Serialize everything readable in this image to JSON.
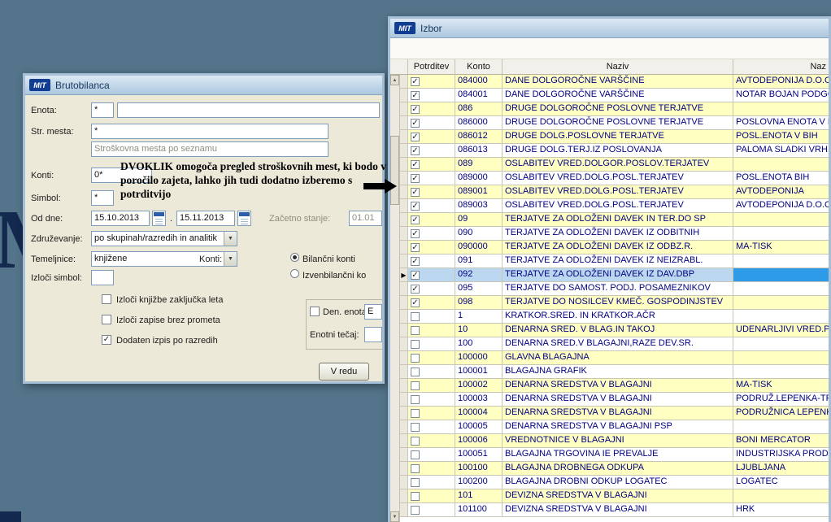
{
  "icons": {
    "dropdown_arrow": "▼",
    "up_arrow": "▲",
    "down_arrow": "▼",
    "check": "✓",
    "record_pointer": "▶"
  },
  "colors": {
    "desktop": "#53748A",
    "row_yellow": "#FFFFC2",
    "row_white": "#FFFFFF",
    "row_selected": "#BCD8F0",
    "active_cell": "#2E9BE8",
    "grid_text": "#000080"
  },
  "brand": {
    "logo": "MIT"
  },
  "background": {
    "letter": "M"
  },
  "annotation": {
    "lines": [
      "DVOKLIK omogoča pregled stroškovnih mest, ki bodo v",
      "poročilo zajeta, lahko jih tudi dodatno izberemo s",
      "potrditvijo"
    ]
  },
  "brutobilanca": {
    "title": "Brutobilanca",
    "enota_label": "Enota:",
    "enota_value": "*",
    "enota_name_value": "",
    "str_mesta_label": "Str. mesta:",
    "str_mesta_value": "*",
    "str_mesta_hint": "Stroškovna mesta po seznamu",
    "konti_label": "Konti:",
    "konti_value": "0*",
    "simbol_label": "Simbol:",
    "simbol_value": "*",
    "od_dne_label": "Od dne:",
    "date_from": "15.10.2013",
    "date_separator": ".",
    "date_to": "15.11.2013",
    "zacetno_stanje_label": "Začetno stanje:",
    "zacetno_stanje_value": "01.01",
    "zdruzevanje_label": "Združevanje:",
    "zdruzevanje_value": "po skupinah/razredih in analitik",
    "temeljnice_label": "Temeljnice:",
    "temeljnice_value": "knjižene",
    "konti_group_label": "Konti:",
    "radio_bilancni_label": "Bilančni konti",
    "radio_izvenbilancni_label": "Izvenbilančni ko",
    "radio_states": {
      "bilancni": true,
      "izvenbilancni": false
    },
    "izloci_simbol_label": "Izloči simbol:",
    "izloci_simbol_value": "",
    "checkbox_izloci_knjizbe_label": "Izloči knjižbe zaključka leta",
    "checkbox_izloci_zapise_label": "Izloči zapise brez prometa",
    "checkbox_dodaten_izpis_label": "Dodaten izpis po razredih",
    "checkbox_states": {
      "izloci_knjizbe": false,
      "izloci_zapise": false,
      "dodaten_izpis": true,
      "den_enota": false
    },
    "den_enota_label": "Den. enota:",
    "den_enota_value": "E",
    "enotni_tecaj_label": "Enotni tečaj:",
    "enotni_tecaj_value": "",
    "ok_button": "V redu"
  },
  "izbor": {
    "title": "Izbor",
    "columns": [
      "Potrditev",
      "Konto",
      "Naziv",
      "Naz"
    ],
    "selected_index": 14,
    "rows": [
      {
        "checked": true,
        "konto": "084000",
        "naziv": "DANE DOLGOROČNE VARŠČINE",
        "naziv2": "AVTODEPONIJA D.O.O."
      },
      {
        "checked": true,
        "konto": "084001",
        "naziv": "DANE DOLGOROČNE VARŠČINE",
        "naziv2": "NOTAR BOJAN PODGO"
      },
      {
        "checked": true,
        "konto": "086",
        "naziv": "DRUGE DOLGOROČNE POSLOVNE TERJATVE",
        "naziv2": ""
      },
      {
        "checked": true,
        "konto": "086000",
        "naziv": "DRUGE DOLGOROČNE POSLOVNE TERJATVE",
        "naziv2": "POSLOVNA ENOTA V B"
      },
      {
        "checked": true,
        "konto": "086012",
        "naziv": "DRUGE DOLG.POSLOVNE TERJATVE",
        "naziv2": "POSL.ENOTA V BIH"
      },
      {
        "checked": true,
        "konto": "086013",
        "naziv": "DRUGE DOLG.TERJ.IZ POSLOVANJA",
        "naziv2": "PALOMA SLADKI VRH"
      },
      {
        "checked": true,
        "konto": "089",
        "naziv": "OSLABITEV VRED.DOLGOR.POSLOV.TERJATEV",
        "naziv2": ""
      },
      {
        "checked": true,
        "konto": "089000",
        "naziv": "OSLABITEV VRED.DOLG.POSL.TERJATEV",
        "naziv2": "POSL.ENOTA BIH"
      },
      {
        "checked": true,
        "konto": "089001",
        "naziv": "OSLABITEV VRED.DOLG.POSL.TERJATEV",
        "naziv2": "AVTODEPONIJA"
      },
      {
        "checked": true,
        "konto": "089003",
        "naziv": "OSLABITEV VRED.DOLG.POSL.TERJATEV",
        "naziv2": "AVTODEPONIJA D.O.O."
      },
      {
        "checked": true,
        "konto": "09",
        "naziv": "TERJATVE ZA ODLOŽENI DAVEK IN TER.DO SP",
        "naziv2": ""
      },
      {
        "checked": true,
        "konto": "090",
        "naziv": "TERJATVE ZA ODLOŽENI DAVEK IZ ODBITNIH",
        "naziv2": ""
      },
      {
        "checked": true,
        "konto": "090000",
        "naziv": "TERJATVE ZA ODLOŽENI DAVEK IZ ODBZ.R.",
        "naziv2": "MA-TISK"
      },
      {
        "checked": true,
        "konto": "091",
        "naziv": "TERJATVE ZA ODLOŽENI DAVEK IZ NEIZRABL.",
        "naziv2": ""
      },
      {
        "checked": true,
        "konto": "092",
        "naziv": "TERJATVE ZA ODLOŽENI DAVEK IZ DAV.DBP",
        "naziv2": ""
      },
      {
        "checked": true,
        "konto": "095",
        "naziv": "TERJATVE DO SAMOST. PODJ. POSAMEZNIKOV",
        "naziv2": ""
      },
      {
        "checked": true,
        "konto": "098",
        "naziv": "TERJATVE DO NOSILCEV KMEČ. GOSPODINJSTEV",
        "naziv2": ""
      },
      {
        "checked": false,
        "konto": "1",
        "naziv": "KRATKOR.SRED. IN KRATKOR.AČR",
        "naziv2": ""
      },
      {
        "checked": false,
        "konto": "10",
        "naziv": "DENARNA SRED. V BLAG.IN TAKOJ",
        "naziv2": "UDENARLJIVI VRED.PA"
      },
      {
        "checked": false,
        "konto": "100",
        "naziv": "DENARNA SRED.V BLAGAJNI,RAZE DEV.SR.",
        "naziv2": ""
      },
      {
        "checked": false,
        "konto": "100000",
        "naziv": "GLAVNA BLAGAJNA",
        "naziv2": ""
      },
      {
        "checked": false,
        "konto": "100001",
        "naziv": "BLAGAJNA GRAFIK",
        "naziv2": ""
      },
      {
        "checked": false,
        "konto": "100002",
        "naziv": "DENARNA SREDSTVA V BLAGAJNI",
        "naziv2": "MA-TISK"
      },
      {
        "checked": false,
        "konto": "100003",
        "naziv": "DENARNA SREDSTVA V BLAGAJNI",
        "naziv2": "PODRUŽ.LEPENKA-TR"
      },
      {
        "checked": false,
        "konto": "100004",
        "naziv": "DENARNA SREDSTVA V BLAGAJNI",
        "naziv2": "PODRUŽNICA LEPENK"
      },
      {
        "checked": false,
        "konto": "100005",
        "naziv": "DENARNA SREDSTVA V BLAGAJNI PSP",
        "naziv2": ""
      },
      {
        "checked": false,
        "konto": "100006",
        "naziv": "VREDNOTNICE V BLAGAJNI",
        "naziv2": "BONI MERCATOR"
      },
      {
        "checked": false,
        "konto": "100051",
        "naziv": "BLAGAJNA TRGOVINA IE PREVALJE",
        "naziv2": "INDUSTRIJSKA PRODA"
      },
      {
        "checked": false,
        "konto": "100100",
        "naziv": "BLAGAJNA DROBNEGA ODKUPA",
        "naziv2": "LJUBLJANA"
      },
      {
        "checked": false,
        "konto": "100200",
        "naziv": "BLAGAJNA DROBNI ODKUP LOGATEC",
        "naziv2": "LOGATEC"
      },
      {
        "checked": false,
        "konto": "101",
        "naziv": "DEVIZNA SREDSTVA V BLAGAJNI",
        "naziv2": ""
      },
      {
        "checked": false,
        "konto": "101100",
        "naziv": "DEVIZNA SREDSTVA V BLAGAJNI",
        "naziv2": "HRK"
      }
    ]
  }
}
